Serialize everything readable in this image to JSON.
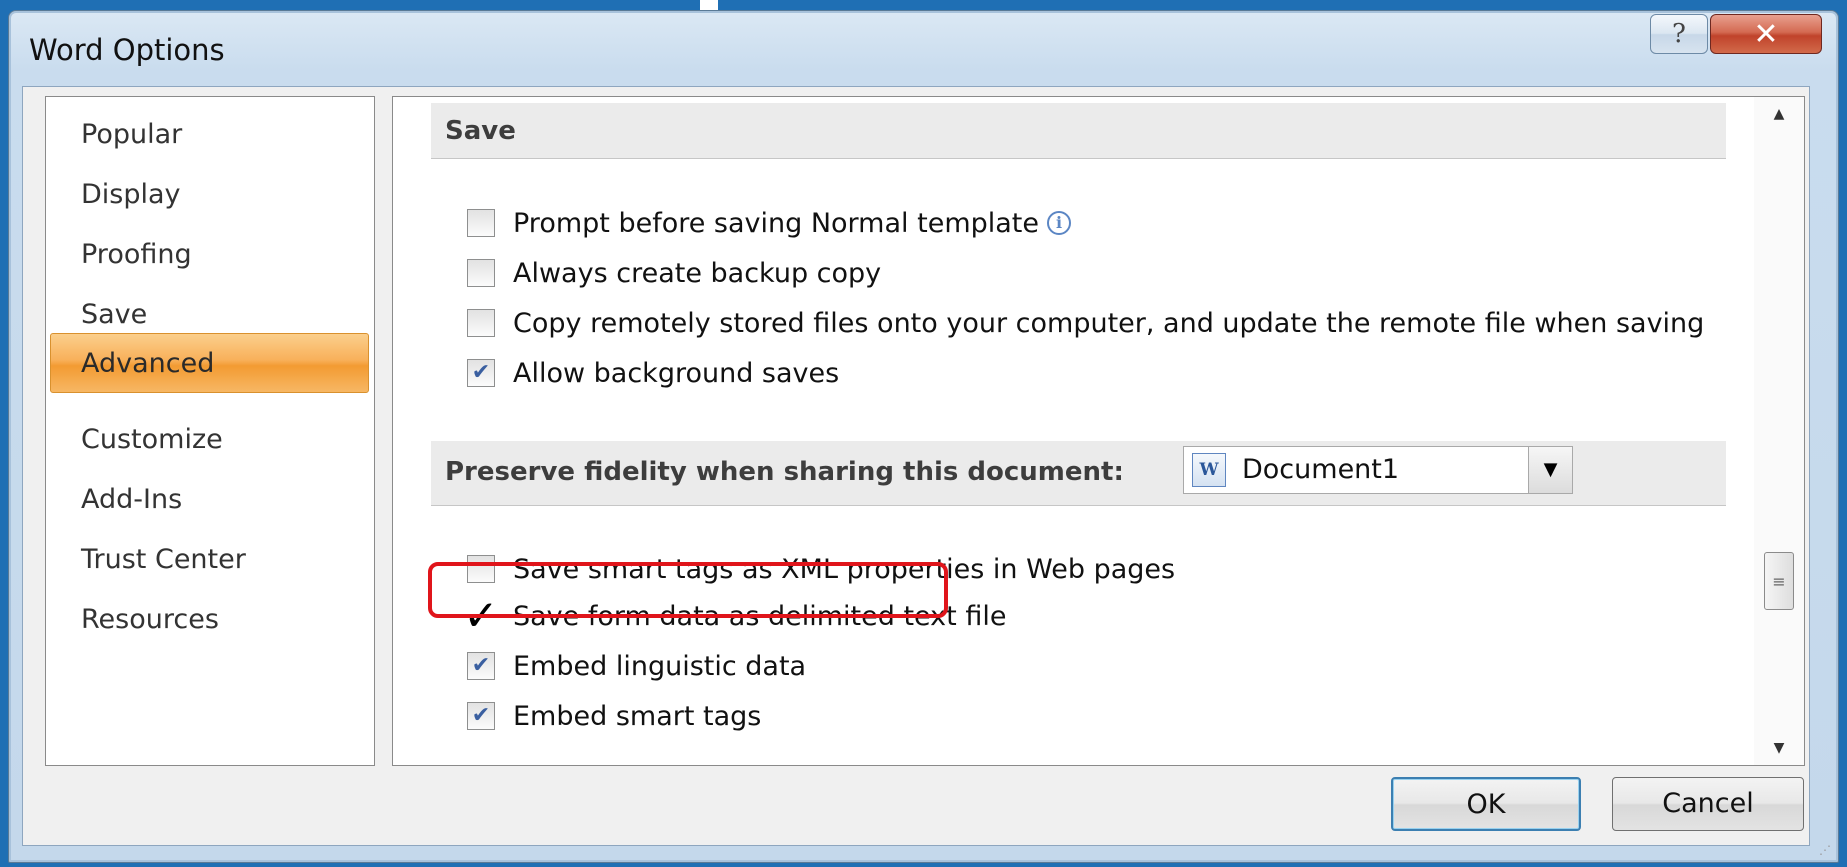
{
  "window": {
    "title": "Word Options",
    "help_glyph": "?",
    "close_glyph": "✕"
  },
  "nav": {
    "items": [
      {
        "label": "Popular",
        "selected": false
      },
      {
        "label": "Display",
        "selected": false
      },
      {
        "label": "Proofing",
        "selected": false
      },
      {
        "label": "Save",
        "selected": false
      },
      {
        "label": "Advanced",
        "selected": true
      },
      {
        "label": "Customize",
        "selected": false
      },
      {
        "label": "Add-Ins",
        "selected": false
      },
      {
        "label": "Trust Center",
        "selected": false
      },
      {
        "label": "Resources",
        "selected": false
      }
    ]
  },
  "save_section": {
    "header": "Save",
    "options": [
      {
        "label": "Prompt before saving Normal template",
        "checked": false,
        "icon": "info-icon"
      },
      {
        "label": "Always create backup copy",
        "checked": false
      },
      {
        "label": "Copy remotely stored files onto your computer, and update the remote file when saving",
        "checked": false
      },
      {
        "label": "Allow background saves",
        "checked": true
      }
    ]
  },
  "fidelity_section": {
    "header": "Preserve fidelity when sharing this document:",
    "document_select": {
      "value": "Document1",
      "icon": "word-document-icon"
    },
    "options": [
      {
        "label": "Save smart tags as XML properties in Web pages",
        "checked": false
      },
      {
        "label": "Save form data as delimited text file",
        "checked": true,
        "highlighted": true
      },
      {
        "label": "Embed linguistic data",
        "checked": true
      },
      {
        "label": "Embed smart tags",
        "checked": true
      }
    ]
  },
  "buttons": {
    "ok": "OK",
    "cancel": "Cancel"
  },
  "colors": {
    "highlight": "#e0151b",
    "selected_nav": "#f8b05a",
    "checkmark": "#3a5fa0"
  }
}
